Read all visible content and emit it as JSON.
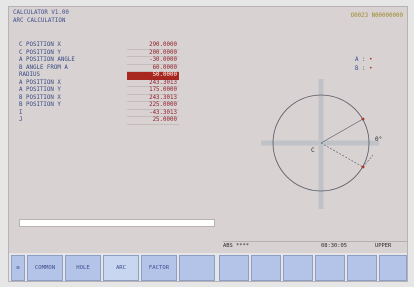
{
  "header": {
    "title": "CALCULATOR V1.00",
    "subtitle": "ARC CALCULATION",
    "top_right": "O0023 N00000000"
  },
  "params": [
    {
      "label": "C POSITION X",
      "value": "290.0000",
      "selected": false
    },
    {
      "label": "C POSITION Y",
      "value": "200.0000",
      "selected": false
    },
    {
      "label": "A POSITION ANGLE",
      "value": "-30.0000",
      "selected": false
    },
    {
      "label": "B ANGLE FROM A",
      "value": "60.0000",
      "selected": false
    },
    {
      "label": "RADIUS",
      "value": "50.0000",
      "selected": true
    },
    {
      "label": "A POSITION X",
      "value": "243.3013",
      "selected": false
    },
    {
      "label": "A POSITION Y",
      "value": "175.0000",
      "selected": false
    },
    {
      "label": "B POSITION X",
      "value": "243.3013",
      "selected": false
    },
    {
      "label": "B POSITION Y",
      "value": "225.0000",
      "selected": false
    },
    {
      "label": "I",
      "value": "-43.3013",
      "selected": false
    },
    {
      "label": "J",
      "value": "25.0000",
      "selected": false
    }
  ],
  "legend": [
    {
      "label": "A :",
      "marker": "red-dot"
    },
    {
      "label": "B :",
      "marker": "red-dot"
    }
  ],
  "diagram": {
    "center_label": "C",
    "angle_label": "0°"
  },
  "input_value": "",
  "status": {
    "mode": "ABS ****",
    "time": "08:30:05",
    "case": "UPPER"
  },
  "softkeys": [
    {
      "label": "≡",
      "type": "icon"
    },
    {
      "label": "COMMON",
      "type": "key"
    },
    {
      "label": "HOLE",
      "type": "key"
    },
    {
      "label": "ARC",
      "type": "key",
      "active": true
    },
    {
      "label": "FACTOR",
      "type": "key"
    },
    {
      "label": "",
      "type": "empty"
    },
    {
      "label": "",
      "type": "empty"
    },
    {
      "label": "",
      "type": "empty"
    },
    {
      "label": "",
      "type": "empty"
    },
    {
      "label": "",
      "type": "empty"
    },
    {
      "label": "",
      "type": "empty"
    },
    {
      "label": "",
      "type": "empty"
    }
  ]
}
